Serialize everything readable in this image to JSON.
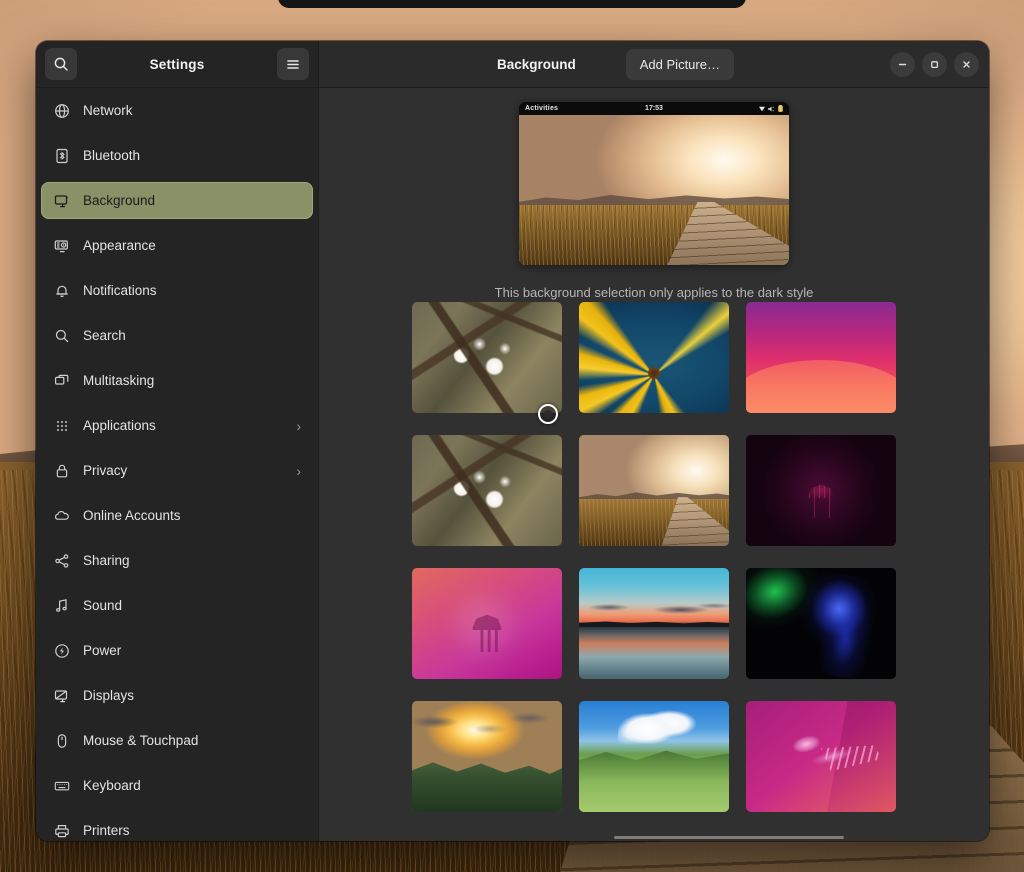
{
  "window": {
    "app_title": "Settings",
    "page_title": "Background",
    "search_icon": "search-icon",
    "menu_icon": "hamburger-menu-icon",
    "add_picture_label": "Add Picture…",
    "minimize_label": "–",
    "maximize_label": "□",
    "close_label": "✕",
    "accent_selected": "#8b9166",
    "sidebar_bg": "#242424",
    "content_bg": "#303030",
    "header_bg": "#2b2b2b"
  },
  "sidebar": {
    "items": [
      {
        "label": "Network",
        "icon": "globe-icon",
        "selected": false,
        "has_chevron": false
      },
      {
        "label": "Bluetooth",
        "icon": "bluetooth-icon",
        "selected": false,
        "has_chevron": false
      },
      {
        "label": "Background",
        "icon": "monitor-icon",
        "selected": true,
        "has_chevron": false
      },
      {
        "label": "Appearance",
        "icon": "appearance-icon",
        "selected": false,
        "has_chevron": false
      },
      {
        "label": "Notifications",
        "icon": "bell-icon",
        "selected": false,
        "has_chevron": false
      },
      {
        "label": "Search",
        "icon": "search-icon",
        "selected": false,
        "has_chevron": false
      },
      {
        "label": "Multitasking",
        "icon": "windows-icon",
        "selected": false,
        "has_chevron": false
      },
      {
        "label": "Applications",
        "icon": "grid-dots-icon",
        "selected": false,
        "has_chevron": true
      },
      {
        "label": "Privacy",
        "icon": "lock-icon",
        "selected": false,
        "has_chevron": true
      },
      {
        "label": "Online Accounts",
        "icon": "cloud-icon",
        "selected": false,
        "has_chevron": false
      },
      {
        "label": "Sharing",
        "icon": "share-icon",
        "selected": false,
        "has_chevron": false
      },
      {
        "label": "Sound",
        "icon": "music-note-icon",
        "selected": false,
        "has_chevron": false
      },
      {
        "label": "Power",
        "icon": "power-icon",
        "selected": false,
        "has_chevron": false
      },
      {
        "label": "Displays",
        "icon": "display-icon",
        "selected": false,
        "has_chevron": false
      },
      {
        "label": "Mouse & Touchpad",
        "icon": "mouse-icon",
        "selected": false,
        "has_chevron": false
      },
      {
        "label": "Keyboard",
        "icon": "keyboard-icon",
        "selected": false,
        "has_chevron": false
      },
      {
        "label": "Printers",
        "icon": "printer-icon",
        "selected": false,
        "has_chevron": false
      }
    ]
  },
  "main": {
    "preview": {
      "activities_label": "Activities",
      "clock": "17:53",
      "status_icons": [
        "wifi-icon",
        "volume-icon",
        "battery-icon"
      ],
      "wallpaper_name": "sunset-boardwalk"
    },
    "caption": "This background selection only applies to the dark style",
    "wallpapers": [
      {
        "name": "white-blossom",
        "art": "art-blossom"
      },
      {
        "name": "yellow-daisy",
        "art": "art-daisy"
      },
      {
        "name": "pink-waves",
        "art": "art-pinkwaves"
      },
      {
        "name": "white-blossom-alt",
        "art": "art-blossom"
      },
      {
        "name": "sunset-boardwalk",
        "art": "art-sunsetpath"
      },
      {
        "name": "dark-jellyfish",
        "art": "art-darkjelly"
      },
      {
        "name": "pink-jellyfish",
        "art": "art-jellypink"
      },
      {
        "name": "lake-sunset",
        "art": "art-lake"
      },
      {
        "name": "neon-abstract",
        "art": "art-neon"
      },
      {
        "name": "mountain-sunset",
        "art": "art-mountainsunset"
      },
      {
        "name": "green-hills",
        "art": "art-greenhills"
      },
      {
        "name": "magenta-jellyfish",
        "art": "art-jellyflat"
      }
    ]
  }
}
